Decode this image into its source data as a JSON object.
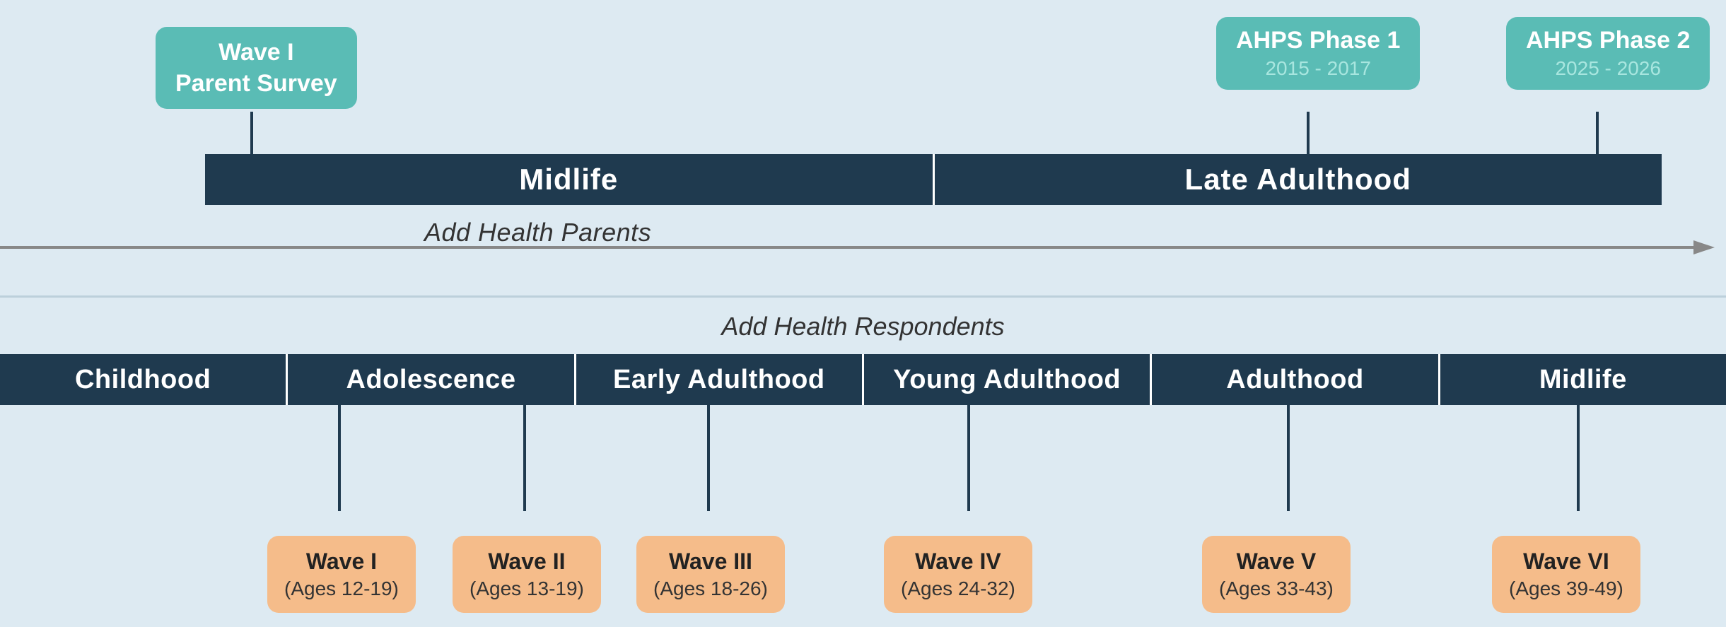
{
  "colors": {
    "bg": "#ddeaf2",
    "bar_dark": "#1f3a4f",
    "teal": "#5abcb5",
    "orange": "#f5bc8a",
    "teal_light": "#a8e6df",
    "arrow": "#888888",
    "divider": "#bcd0db"
  },
  "top": {
    "parents_label": "Add Health Parents",
    "midlife_label": "Midlife",
    "late_adulthood_label": "Late Adulthood",
    "wave_parent_survey": {
      "line1": "Wave I",
      "line2": "Parent Survey"
    },
    "ahps_phase1": {
      "title": "AHPS Phase 1",
      "dates": "2015 - 2017"
    },
    "ahps_phase2": {
      "title": "AHPS Phase 2",
      "dates": "2025 - 2026"
    }
  },
  "bottom": {
    "respondents_label": "Add Health Respondents",
    "segments": [
      "Childhood",
      "Adolescence",
      "Early Adulthood",
      "Young Adulthood",
      "Adulthood",
      "Midlife"
    ],
    "waves": [
      {
        "title": "Wave I",
        "ages": "(Ages 12-19)"
      },
      {
        "title": "Wave II",
        "ages": "(Ages 13-19)"
      },
      {
        "title": "Wave III",
        "ages": "(Ages 18-26)"
      },
      {
        "title": "Wave IV",
        "ages": "(Ages 24-32)"
      },
      {
        "title": "Wave V",
        "ages": "(Ages 33-43)"
      },
      {
        "title": "Wave VI",
        "ages": "(Ages 39-49)"
      }
    ]
  }
}
